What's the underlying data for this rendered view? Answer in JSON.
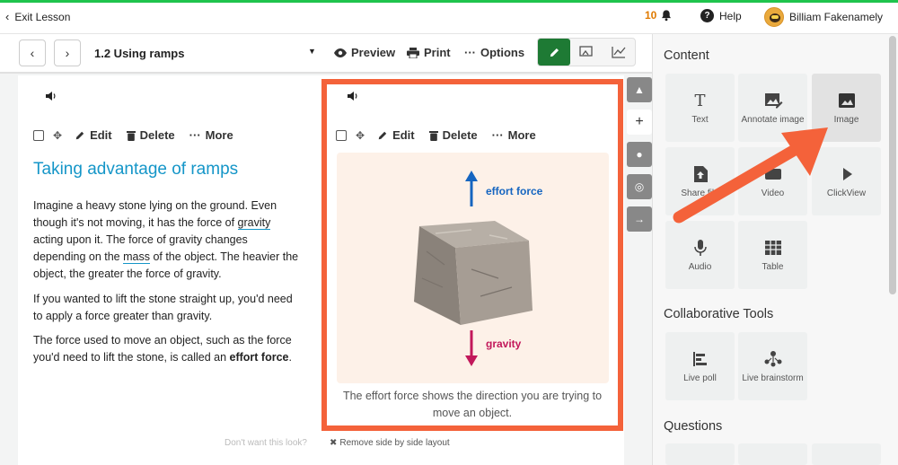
{
  "topbar": {
    "exit_label": "Exit Lesson",
    "notification_count": "10",
    "help_label": "Help",
    "user_name": "Billiam Fakenamely"
  },
  "toolbar": {
    "lesson_title": "1.2 Using ramps",
    "preview_label": "Preview",
    "print_label": "Print",
    "options_label": "Options"
  },
  "left_card": {
    "edit_label": "Edit",
    "delete_label": "Delete",
    "more_label": "More",
    "heading": "Taking advantage of ramps",
    "p1_a": "Imagine a heavy stone lying on the ground. Even though it's not moving, it has the force of ",
    "p1_link1": "gravity",
    "p1_b": " acting upon it. The force of gravity changes depending on the ",
    "p1_link2": "mass",
    "p1_c": " of the object. The heavier the object, the greater the force of gravity.",
    "p2": "If you wanted to lift the stone straight up, you'd need to apply a force greater than gravity.",
    "p3_a": "The force used to move an object, such as the force you'd need to lift the stone, is called an ",
    "p3_bold": "effort force",
    "p3_b": "."
  },
  "right_card": {
    "edit_label": "Edit",
    "delete_label": "Delete",
    "more_label": "More",
    "effort_label": "effort force",
    "gravity_label": "gravity",
    "caption": "The effort force shows the direction you are trying to move an object."
  },
  "footer": {
    "note": "Don't want this look?",
    "remove_label": "Remove side by side layout"
  },
  "panel": {
    "content_heading": "Content",
    "content_tiles": [
      "Text",
      "Annotate image",
      "Image",
      "Share file",
      "Video",
      "ClickView",
      "Audio",
      "Table"
    ],
    "collab_heading": "Collaborative Tools",
    "collab_tiles": [
      "Live poll",
      "Live brainstorm"
    ],
    "questions_heading": "Questions"
  },
  "colors": {
    "accent_green": "#1fc44d",
    "selection_orange": "#f4623a",
    "heading_blue": "#1596c8"
  }
}
